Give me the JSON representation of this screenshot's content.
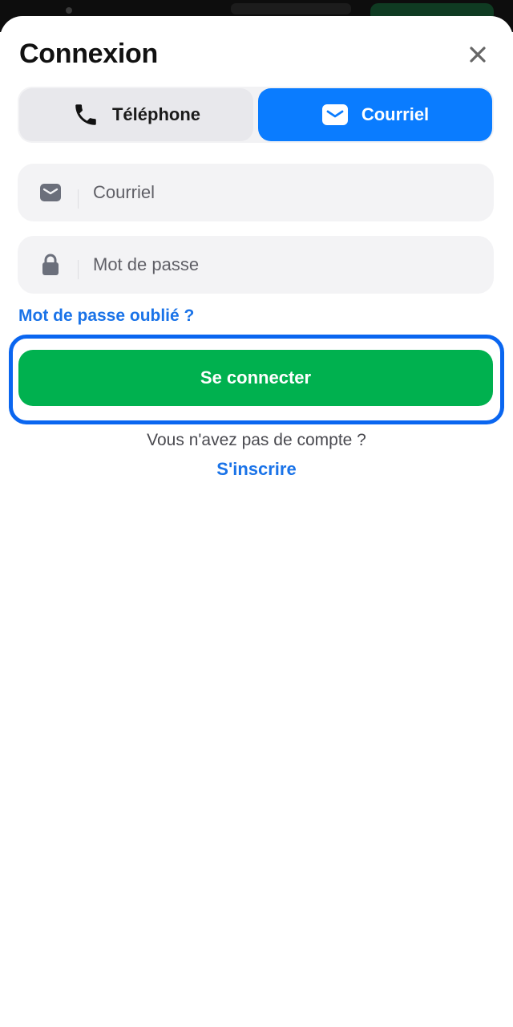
{
  "dialog": {
    "title": "Connexion",
    "close_icon": "close-icon"
  },
  "tabs": [
    {
      "label": "Téléphone",
      "icon": "phone-icon",
      "active": false
    },
    {
      "label": "Courriel",
      "icon": "mail-icon",
      "active": true
    }
  ],
  "form": {
    "email": {
      "placeholder": "Courriel",
      "value": "",
      "icon": "mail-icon"
    },
    "password": {
      "placeholder": "Mot de passe",
      "value": "",
      "icon": "lock-icon"
    },
    "forgot_label": "Mot de passe oublié ?",
    "submit_label": "Se connecter"
  },
  "footer": {
    "prompt": "Vous n'avez pas de compte ?",
    "signup_label": "S'inscrire"
  },
  "colors": {
    "accent_blue": "#0a7cff",
    "link_blue": "#1a73e8",
    "submit_green": "#00b14f",
    "highlight_border": "#0a66f0"
  }
}
